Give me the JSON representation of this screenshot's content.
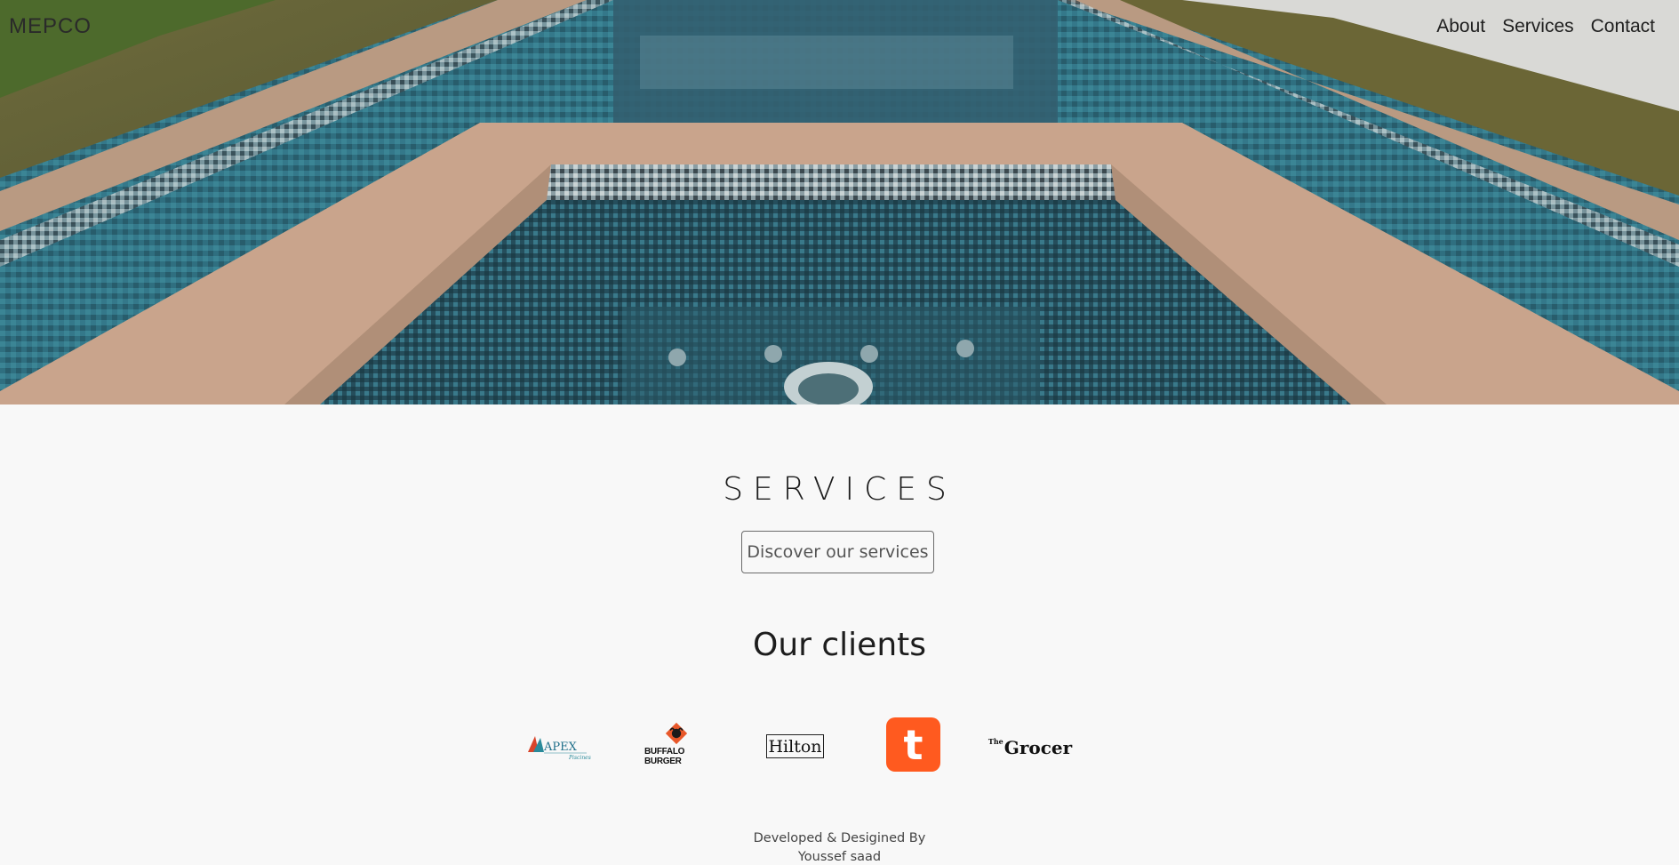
{
  "header": {
    "brand": "MEPCO",
    "nav": [
      "About",
      "Services",
      "Contact"
    ]
  },
  "hero": {
    "image": "pool-with-jacuzzi-mosaic-tiles"
  },
  "services": {
    "title": "SERVICES",
    "button_label": "Discover our services"
  },
  "clients": {
    "title": "Our clients",
    "logos": [
      {
        "name": "APEX",
        "sub": "Piscines"
      },
      {
        "name": "BUFFALO BURGER"
      },
      {
        "name": "Hilton"
      },
      {
        "name": "t"
      },
      {
        "name": "Grocer",
        "prefix": "The"
      }
    ]
  },
  "footer": {
    "line1": "Developed & Desigined By",
    "line2": "Youssef saad"
  },
  "colors": {
    "background": "#f8f8f8",
    "text": "#1d1d1d",
    "talabat_orange": "#ff5a1f"
  }
}
